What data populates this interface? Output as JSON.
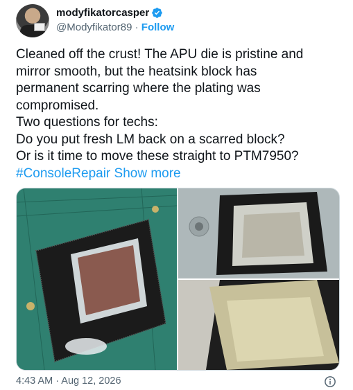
{
  "author": {
    "display_name": "modyfikatorcasper",
    "handle": "@Modyfikator89",
    "separator": " · ",
    "follow_label": "Follow",
    "verified": true
  },
  "tweet": {
    "text": "Cleaned off the crust! The APU die is pristine and\nmirror smooth, but the heatsink block has\npermanent scarring where the plating was\ncompromised.\nTwo questions for techs:\nDo you put fresh LM back on a scarred block?\nOr is it time to move these straight to PTM7950?\n",
    "hashtag": "#ConsoleRepair",
    "show_more": " Show more"
  },
  "media": {
    "images": [
      "apu-die-on-board-photo",
      "heatsink-block-photo",
      "heatsink-scarring-closeup-photo"
    ]
  },
  "footer": {
    "timestamp": "4:43 AM · Aug 12, 2026",
    "info_icon": "info-icon"
  },
  "colors": {
    "accent": "#1d9bf0",
    "secondary_text": "#536471",
    "text": "#0f1419"
  }
}
